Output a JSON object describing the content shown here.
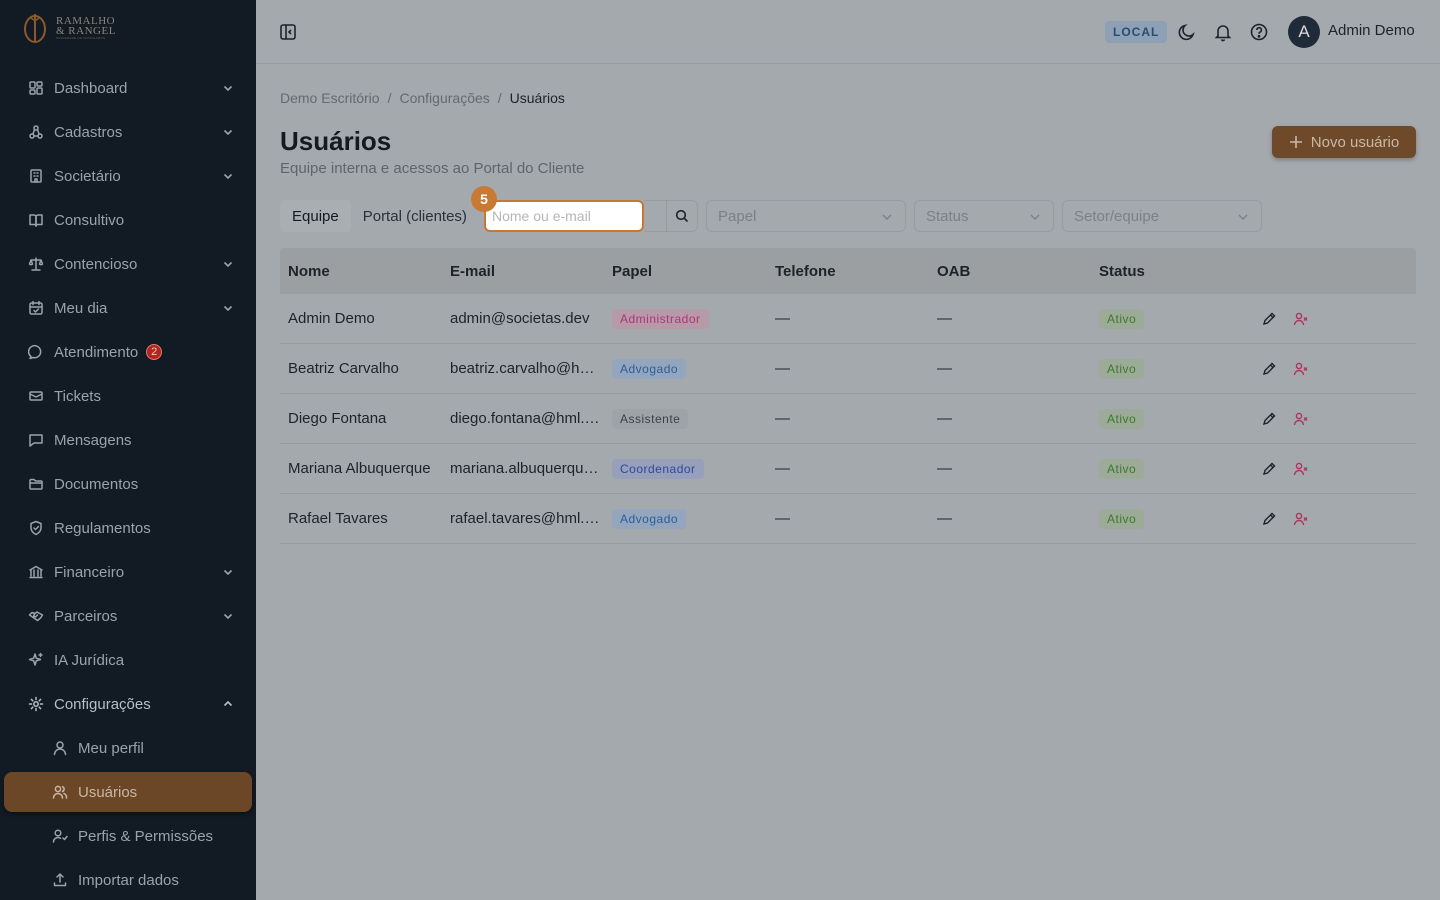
{
  "brand": {
    "line1": "RAMALHO",
    "line2": "& RANGEL",
    "tagline": "SOCIEDADE DE ADVOGADOS"
  },
  "sidebar": {
    "items": [
      {
        "label": "Dashboard",
        "icon": "dashboard-icon",
        "expandable": true
      },
      {
        "label": "Cadastros",
        "icon": "network-icon",
        "expandable": true
      },
      {
        "label": "Societário",
        "icon": "building-icon",
        "expandable": true
      },
      {
        "label": "Consultivo",
        "icon": "book-icon",
        "expandable": false
      },
      {
        "label": "Contencioso",
        "icon": "scale-icon",
        "expandable": true
      },
      {
        "label": "Meu dia",
        "icon": "calendar-icon",
        "expandable": true
      },
      {
        "label": "Atendimento",
        "icon": "chat-icon",
        "expandable": false,
        "badge": "2"
      },
      {
        "label": "Tickets",
        "icon": "ticket-icon",
        "expandable": false
      },
      {
        "label": "Mensagens",
        "icon": "message-icon",
        "expandable": false
      },
      {
        "label": "Documentos",
        "icon": "folder-icon",
        "expandable": false
      },
      {
        "label": "Regulamentos",
        "icon": "shield-icon",
        "expandable": false
      },
      {
        "label": "Financeiro",
        "icon": "bank-icon",
        "expandable": true
      },
      {
        "label": "Parceiros",
        "icon": "handshake-icon",
        "expandable": true
      },
      {
        "label": "IA Jurídica",
        "icon": "sparkles-icon",
        "expandable": false
      },
      {
        "label": "Configurações",
        "icon": "gear-icon",
        "expandable": true,
        "open": true
      }
    ],
    "subitems": [
      {
        "label": "Meu perfil",
        "icon": "user-icon"
      },
      {
        "label": "Usuários",
        "icon": "users-icon",
        "active": true
      },
      {
        "label": "Perfis & Permissões",
        "icon": "user-key-icon"
      },
      {
        "label": "Importar dados",
        "icon": "upload-icon"
      }
    ]
  },
  "topbar": {
    "env": "LOCAL",
    "avatar_initial": "A",
    "user_name": "Admin Demo"
  },
  "breadcrumb": {
    "items": [
      "Demo Escritório",
      "Configurações"
    ],
    "current": "Usuários",
    "separator": "/"
  },
  "page": {
    "title": "Usuários",
    "subtitle": "Equipe interna e acessos ao Portal do Cliente",
    "new_button": "Novo usuário"
  },
  "tabs": [
    "Equipe",
    "Portal (clientes)"
  ],
  "filters": {
    "search_placeholder": "Nome ou e-mail",
    "step_badge": "5",
    "role_placeholder": "Papel",
    "status_placeholder": "Status",
    "team_placeholder": "Setor/equipe"
  },
  "table": {
    "headers": [
      "Nome",
      "E-mail",
      "Papel",
      "Telefone",
      "OAB",
      "Status"
    ],
    "rows": [
      {
        "name": "Admin Demo",
        "email": "admin@societas.dev",
        "role": "Administrador",
        "role_style": "admin",
        "phone": "—",
        "oab": "—",
        "status": "Ativo"
      },
      {
        "name": "Beatriz Carvalho",
        "email": "beatriz.carvalho@hml.dev",
        "role": "Advogado",
        "role_style": "lawyer",
        "phone": "—",
        "oab": "—",
        "status": "Ativo"
      },
      {
        "name": "Diego Fontana",
        "email": "diego.fontana@hml.dev",
        "role": "Assistente",
        "role_style": "assistant",
        "phone": "—",
        "oab": "—",
        "status": "Ativo"
      },
      {
        "name": "Mariana Albuquerque",
        "email": "mariana.albuquerque@hml.dev",
        "role": "Coordenador",
        "role_style": "coord",
        "phone": "—",
        "oab": "—",
        "status": "Ativo"
      },
      {
        "name": "Rafael Tavares",
        "email": "rafael.tavares@hml.dev",
        "role": "Advogado",
        "role_style": "lawyer",
        "phone": "—",
        "oab": "—",
        "status": "Ativo"
      }
    ]
  },
  "colors": {
    "sidebar_bg": "#121a23",
    "accent": "#6e4a2b",
    "focus_ring": "#c77a2e",
    "role_admin": "#b0347a",
    "role_lawyer": "#2e5d9a",
    "role_coord": "#2e4a9a",
    "status_active": "#3b7a2a"
  }
}
